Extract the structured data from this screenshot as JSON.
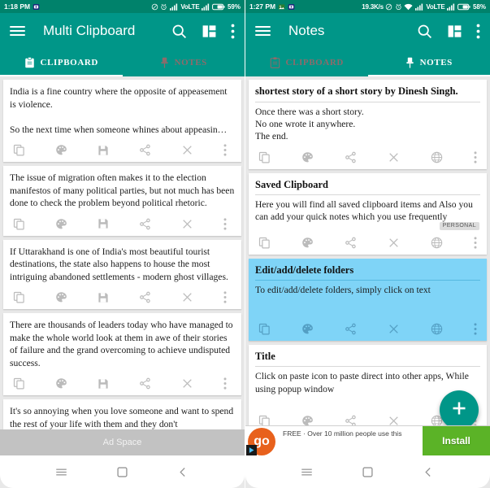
{
  "left": {
    "status": {
      "time": "1:18 PM",
      "icons": [
        "message-icon",
        "mute-icon",
        "alarm-icon",
        "signal-icon",
        "signal-2-icon",
        "battery-icon"
      ],
      "volte": "VoLTE",
      "battery": "59%"
    },
    "toolbar": {
      "menu": "menu-icon",
      "title": "Multi Clipboard",
      "search": "search-icon",
      "dashboard": "dashboard-icon",
      "overflow": "more-vert-icon"
    },
    "tabs": [
      {
        "label": "CLIPBOARD",
        "icon": "clipboard-icon",
        "active": true
      },
      {
        "label": "NOTES",
        "icon": "pin-icon",
        "active": false
      }
    ],
    "cards": [
      {
        "body": "India is a fine country where the opposite of appeasement is violence.\n\nSo the next time when someone whines about appeasin…",
        "actions": [
          "copy-icon",
          "palette-icon",
          "save-icon",
          "share-icon",
          "close-icon",
          "more-vert-icon"
        ]
      },
      {
        "body": "The issue of migration often makes it to the election manifestos of many political parties, but not much has been done to check the problem beyond political rhetoric.",
        "actions": [
          "copy-icon",
          "palette-icon",
          "save-icon",
          "share-icon",
          "close-icon",
          "more-vert-icon"
        ]
      },
      {
        "body": "If Uttarakhand is one of India's most beautiful tourist destinations, the state also happens to house the most intriguing abandoned settlements - modern ghost villages.",
        "actions": [
          "copy-icon",
          "palette-icon",
          "save-icon",
          "share-icon",
          "close-icon",
          "more-vert-icon"
        ]
      },
      {
        "body": "There are thousands of leaders today who have managed to make the whole world look at them in awe of their stories of failure and the grand overcoming to achieve undisputed success.",
        "actions": [
          "copy-icon",
          "palette-icon",
          "save-icon",
          "share-icon",
          "close-icon",
          "more-vert-icon"
        ]
      },
      {
        "body": "It's so annoying when you love someone and want to spend the rest of your life with them and they don't",
        "actions": []
      }
    ],
    "ad": {
      "label": "Ad Space"
    },
    "nav": [
      "recents-icon",
      "home-icon",
      "back-icon"
    ]
  },
  "right": {
    "status": {
      "time": "1:27 PM",
      "rate": "19.3K/s",
      "icons": [
        "photo-icon",
        "message-icon",
        "mute-icon",
        "alarm-icon",
        "wifi-icon",
        "signal-icon",
        "signal-2-icon",
        "battery-icon"
      ],
      "volte": "VoLTE",
      "battery": "58%"
    },
    "toolbar": {
      "menu": "menu-icon",
      "title": "Notes",
      "search": "search-icon",
      "dashboard": "dashboard-icon",
      "overflow": "more-vert-icon"
    },
    "tabs": [
      {
        "label": "CLIPBOARD",
        "icon": "clipboard-icon",
        "active": false
      },
      {
        "label": "NOTES",
        "icon": "pin-icon",
        "active": true
      }
    ],
    "cards": [
      {
        "title": "shortest story of a short story by Dinesh Singh.",
        "body": "Once there was a short story.\nNo one wrote it anywhere.\nThe end.",
        "badge": null,
        "highlight": false,
        "actions": [
          "copy-icon",
          "palette-icon",
          "share-icon",
          "close-icon",
          "globe-icon",
          "more-vert-icon"
        ]
      },
      {
        "title": "Saved Clipboard",
        "body": "Here you will find all saved clipboard items and Also you can add your quick notes which you use frequently",
        "badge": "PERSONAL",
        "highlight": false,
        "actions": [
          "copy-icon",
          "palette-icon",
          "share-icon",
          "close-icon",
          "globe-icon",
          "more-vert-icon"
        ]
      },
      {
        "title": "Edit/add/delete folders",
        "body": "To edit/add/delete folders, simply click on text",
        "badge": null,
        "highlight": true,
        "actions": [
          "copy-icon",
          "palette-icon",
          "share-icon",
          "close-icon",
          "globe-icon",
          "more-vert-icon"
        ]
      },
      {
        "title": "Title",
        "body": "Click on paste icon to paste direct into other apps, While using popup window",
        "badge": null,
        "highlight": false,
        "actions": [
          "copy-icon",
          "palette-icon",
          "share-icon",
          "close-icon",
          "globe-icon",
          "more-vert-icon"
        ]
      }
    ],
    "fab": {
      "icon": "add-icon",
      "label": "+"
    },
    "ad": {
      "logo_text": "go",
      "text": "FREE · Over 10 million people use this",
      "install": "Install"
    },
    "nav": [
      "recents-icon",
      "home-icon",
      "back-icon"
    ]
  },
  "colors": {
    "primary": "#009688",
    "status_bar": "#00826b",
    "highlight_card": "#7fd4f7",
    "install_green": "#5bb327",
    "ad_orange": "#e8611c",
    "inactive_tab": "#8d6b6b"
  }
}
